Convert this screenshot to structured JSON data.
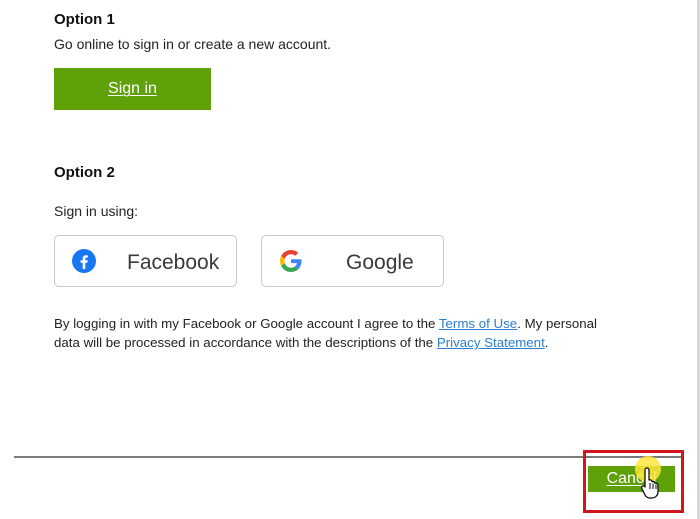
{
  "option1": {
    "heading": "Option 1",
    "description": "Go online to sign in or create a new account.",
    "signin_label": "Sign in"
  },
  "option2": {
    "heading": "Option 2",
    "description": "Sign in using:",
    "facebook_label": "Facebook",
    "google_label": "Google"
  },
  "legal": {
    "text_before": "By logging in with my Facebook or Google account I agree to the ",
    "terms_link": "Terms of Use",
    "text_middle": ". My personal data will be processed in accordance with the descriptions of the ",
    "privacy_link": "Privacy Statement",
    "text_after": "."
  },
  "footer": {
    "cancel_label": "Cancel"
  },
  "colors": {
    "accent_green": "#5ea108",
    "link_blue": "#2a7fd0",
    "highlight_red": "#d2151c",
    "facebook_blue": "#1877f2"
  },
  "icons": [
    "facebook-icon",
    "google-icon",
    "hand-cursor-icon"
  ]
}
